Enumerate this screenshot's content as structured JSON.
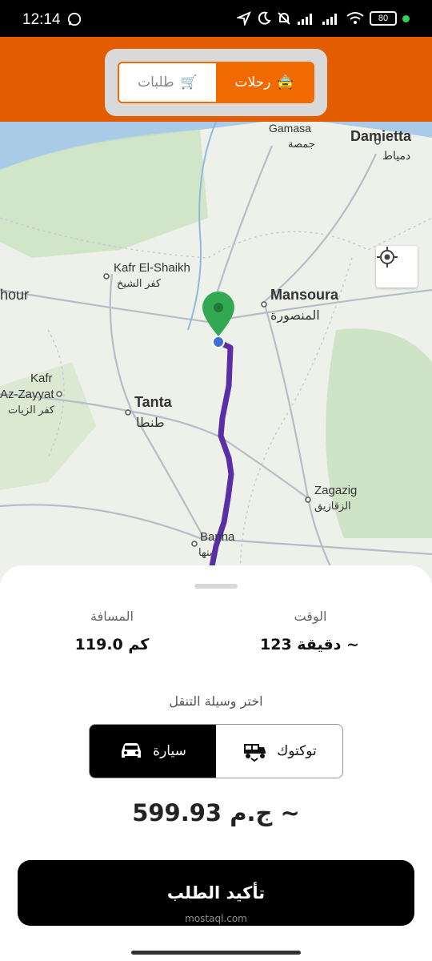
{
  "status_bar": {
    "time": "12:14",
    "battery": "80"
  },
  "header": {
    "tabs": [
      {
        "label": "رحلات",
        "emoji": "🚖"
      },
      {
        "label": "طلبات",
        "emoji": "🛒"
      }
    ]
  },
  "map": {
    "places": {
      "gamasa_en": "Gamasa",
      "gamasa_ar": "جمصة",
      "damietta_en": "Damietta",
      "damietta_ar": "دمياط",
      "kafr_elshaikh_en": "Kafr El-Shaikh",
      "kafr_elshaikh_ar": "كفر الشيخ",
      "mansoura_en": "Mansoura",
      "mansoura_ar": "المنصورة",
      "damanhour_partial": "hour",
      "kafr_zayyat_en1": "Kafr",
      "kafr_zayyat_en2": "Az-Zayyat",
      "kafr_zayyat_ar": "كفر الزيات",
      "tanta_en": "Tanta",
      "tanta_ar": "طنطا",
      "zagazig_en": "Zagazig",
      "zagazig_ar": "الزقازيق",
      "banha_en": "Banha",
      "banha_ar": "بنها"
    }
  },
  "trip": {
    "time_label": "الوقت",
    "time_value": "123 دقيقة ~",
    "distance_label": "المسافة",
    "distance_value": "119.0 كم",
    "choose_label": "اختر وسيلة التنقل",
    "modes": [
      {
        "label": "توكتوك",
        "icon": "tuktuk-icon",
        "active": false
      },
      {
        "label": "سيارة",
        "icon": "car-icon",
        "active": true
      }
    ],
    "price": "599.93 ج.م ~",
    "confirm_label": "تأكيد الطلب"
  },
  "watermark": "mostaql.com",
  "colors": {
    "accent": "#f06a00",
    "header": "#e35c00",
    "route": "#5a2ea6",
    "pin": "#33a852"
  }
}
